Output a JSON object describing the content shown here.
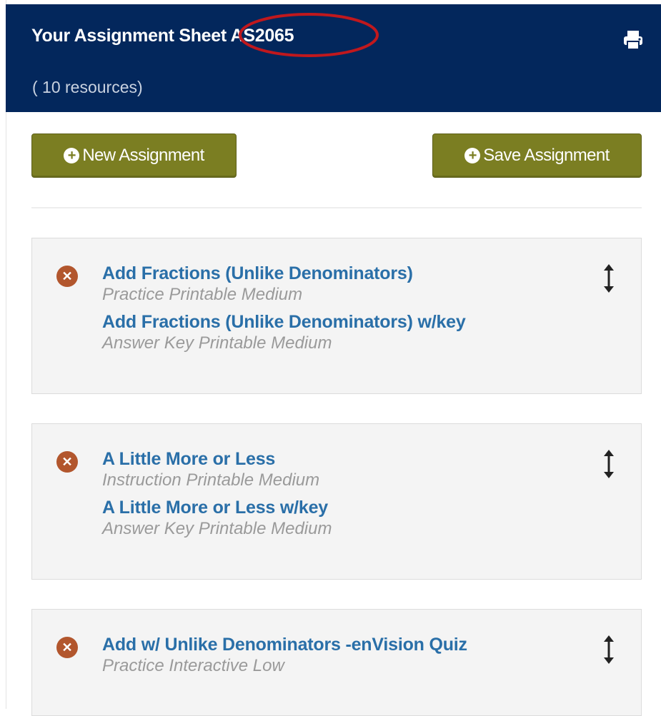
{
  "header": {
    "title": "Your Assignment Sheet AS2065",
    "subtitle": "( 10 resources)"
  },
  "icons": {
    "print": "print-icon",
    "remove": "remove-icon",
    "drag": "drag-vertical-icon",
    "plus": "plus-circle-icon"
  },
  "buttons": {
    "new_assignment": "New Assignment",
    "save_assignment": "Save Assignment"
  },
  "cards": [
    {
      "resources": [
        {
          "title": "Add Fractions (Unlike Denominators)",
          "meta": "Practice Printable Medium"
        },
        {
          "title": "Add Fractions (Unlike Denominators) w/key",
          "meta": "Answer Key Printable Medium"
        }
      ]
    },
    {
      "resources": [
        {
          "title": "A Little More or Less",
          "meta": "Instruction Printable Medium"
        },
        {
          "title": "A Little More or Less w/key",
          "meta": "Answer Key Printable Medium"
        }
      ]
    },
    {
      "resources": [
        {
          "title": "Add w/ Unlike Denominators -enVision Quiz",
          "meta": "Practice Interactive Low"
        }
      ]
    }
  ],
  "colors": {
    "header_bg": "#03275c",
    "button_bg": "#7b7e22",
    "link": "#2a6fa8",
    "remove_icon": "#b2562d",
    "annotation": "#c0181d"
  }
}
